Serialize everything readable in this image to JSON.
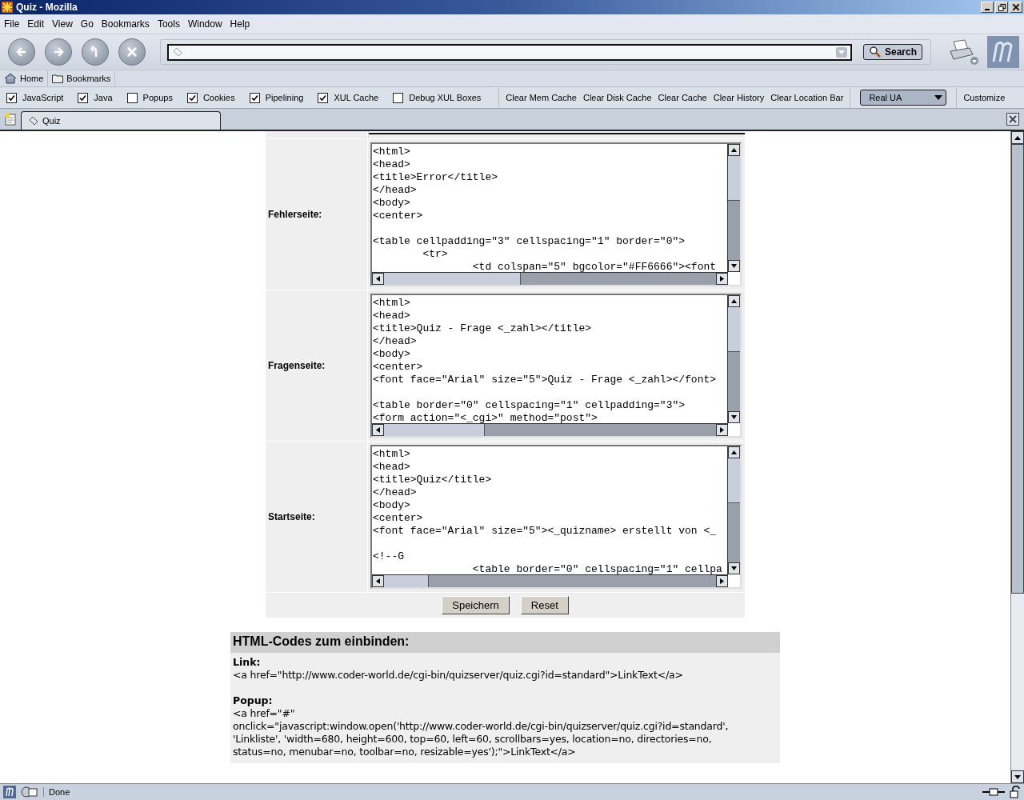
{
  "window": {
    "title": "Quiz - Mozilla"
  },
  "menu": [
    "File",
    "Edit",
    "View",
    "Go",
    "Bookmarks",
    "Tools",
    "Window",
    "Help"
  ],
  "navigation": {
    "search_button": "Search"
  },
  "personal_toolbar": [
    {
      "label": "Home",
      "kind": "home"
    },
    {
      "label": "Bookmarks",
      "kind": "folder"
    }
  ],
  "prefbar": {
    "options": [
      {
        "label": "JavaScript",
        "checked": true
      },
      {
        "label": "Java",
        "checked": true
      },
      {
        "label": "Popups",
        "checked": false
      },
      {
        "label": "Cookies",
        "checked": true
      },
      {
        "label": "Pipelining",
        "checked": true
      },
      {
        "label": "XUL Cache",
        "checked": true
      },
      {
        "label": "Debug XUL Boxes",
        "checked": false
      }
    ],
    "actions": [
      "Clear Mem Cache",
      "Clear Disk Cache",
      "Clear Cache",
      "Clear History",
      "Clear Location Bar"
    ],
    "user_agent": "Real UA",
    "customize": "Customize"
  },
  "tabs": [
    {
      "label": "Quiz",
      "selected": true
    }
  ],
  "form": {
    "rows": [
      {
        "label": "Fehlerseite:",
        "value": "<html>\n<head>\n<title>Error</title>\n</head>\n<body>\n<center>\n\n<table cellpadding=\"3\" cellspacing=\"1\" border=\"0\">\n        <tr>\n                <td colspan=\"5\" bgcolor=\"#FF6666\"><font"
      },
      {
        "label": "Fragenseite:",
        "value": "<html>\n<head>\n<title>Quiz - Frage <_zahl></title>\n</head>\n<body>\n<center>\n<font face=\"Arial\" size=\"5\">Quiz - Frage <_zahl></font>\n\n<table border=\"0\" cellspacing=\"1\" cellpadding=\"3\">\n<form action=\"<_cgi>\" method=\"post\">"
      },
      {
        "label": "Startseite:",
        "value": "<html>\n<head>\n<title>Quiz</title>\n</head>\n<body>\n<center>\n<font face=\"Arial\" size=\"5\"><_quizname> erstellt von <_\n\n<!--G\n                <table border=\"0\" cellspacing=\"1\" cellpa"
      }
    ],
    "buttons": [
      "Speichern",
      "Reset"
    ]
  },
  "embed": {
    "title": "HTML-Codes zum einbinden:",
    "sections": [
      {
        "heading": "Link:",
        "code": "<a href=\"http://www.coder-world.de/cgi-bin/quizserver/quiz.cgi?id=standard\">LinkText</a>"
      },
      {
        "heading": "Popup:",
        "code": "<a href=\"#\"\nonclick=\"javascript:window.open('http://www.coder-world.de/cgi-bin/quizserver/quiz.cgi?id=standard',\n'Linkliste', 'width=680, height=600, top=60, left=60, scrollbars=yes, location=no, directories=no,\nstatus=no, menubar=no, toolbar=no, resizable=yes');\">LinkText</a>"
      }
    ]
  },
  "status_bar": {
    "text": "Done"
  }
}
